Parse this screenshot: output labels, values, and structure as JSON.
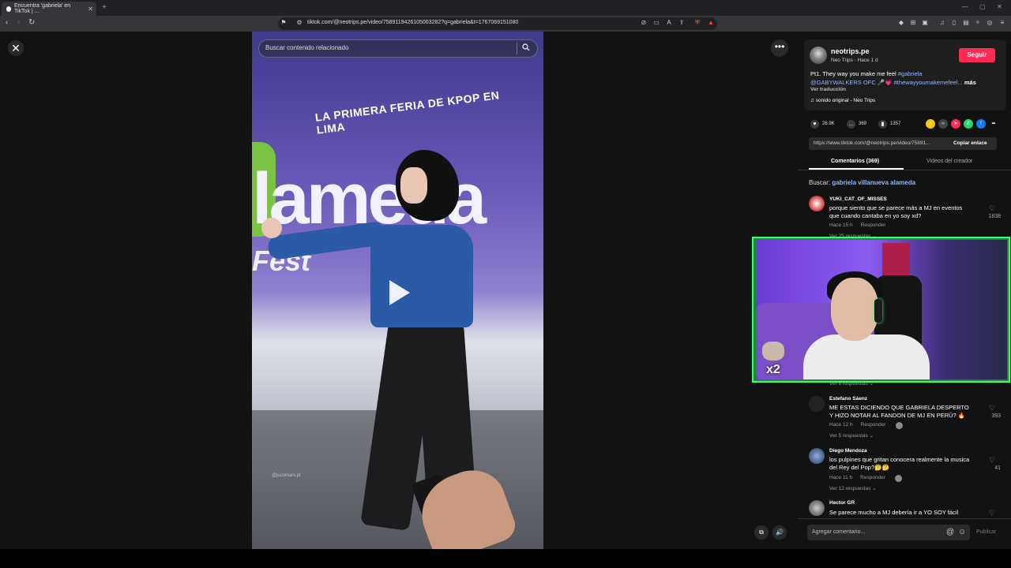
{
  "browser": {
    "tab_title": "Encuentra 'gabriela' en TikTok | ...",
    "url": "tiktok.com/@neotrips.pe/video/758911942610500328​2?q=gabriela&t=1767069151080"
  },
  "video": {
    "search_placeholder": "Buscar contenido relacionado",
    "banner_text": "LA PRIMERA FERIA DE KPOP EN LIMA",
    "brand_big": "lameda",
    "brand_sub": "Fest",
    "watermark": "@jucomarv.pt"
  },
  "author": {
    "name": "neotrips.pe",
    "subtitle": "Neo Trips · Hace 1 d",
    "follow_label": "Seguir",
    "caption_prefix": "Pt1. They way you make me feel ",
    "caption_tag1": "#gabriela",
    "caption_mention": "@GABYWALKERS OFC",
    "caption_tag2": "#thewayyoumakemefeel...",
    "caption_more": "más",
    "translate": "Ver traducción",
    "sound": "♫  sonido original - Neo Trips"
  },
  "stats": {
    "likes": "26.9K",
    "comments": "369",
    "saves": "1357"
  },
  "share": {
    "link": "https://www.tiktok.com/@neotrips.pe/video/75891...",
    "copy_label": "Copiar enlace"
  },
  "tabs": {
    "comments": "Comentarios (369)",
    "creator_videos": "Videos del creador"
  },
  "search_suggestion": {
    "prefix": "Buscar: ",
    "query": "gabriela villanueva alameda"
  },
  "comments": [
    {
      "name": "YUKI_CAT_OF_MISSES",
      "text": "porque siento que se parece más a MJ en eventos que cuando cantaba en yo soy xd?",
      "time": "Hace 15 h",
      "reply": "Responder",
      "replies": "Ver 25 respuestas ⌄",
      "likes": "1838"
    },
    {
      "name": "Estefano Sáenz",
      "text": "ME ESTAS DICIENDO QUE GABRIELA DESPERTO Y HIZO NOTAR AL FANDON DE MJ EN PERÚ? 🔥",
      "time": "Hace 12 h",
      "reply": "Responder",
      "replies": "Ver 5 respuestas ⌄",
      "likes": "393"
    },
    {
      "name": "Diego Mendoza",
      "text": "los pulpines que gritan conocera realmente la musica del Rey del Pop?🤔🤔",
      "time": "Hace 11 h",
      "reply": "Responder",
      "replies": "Ver 12 respuestas ⌄",
      "likes": "41"
    },
    {
      "name": "Hector GR",
      "text": "Se parece mucho a MJ debería ir a YO SOY fácil",
      "time": "",
      "reply": "",
      "replies": "",
      "likes": ""
    }
  ],
  "partial_replies": "Ver 8 respuestas ⌄",
  "comment_input": {
    "placeholder": "Agregar comentario...",
    "publish": "Publicar"
  },
  "webcam": {
    "overlay_text": "x2"
  },
  "colors": {
    "accent": "#fe2c55",
    "link": "#8fb7ff",
    "webcam_border": "#3dff6b"
  }
}
